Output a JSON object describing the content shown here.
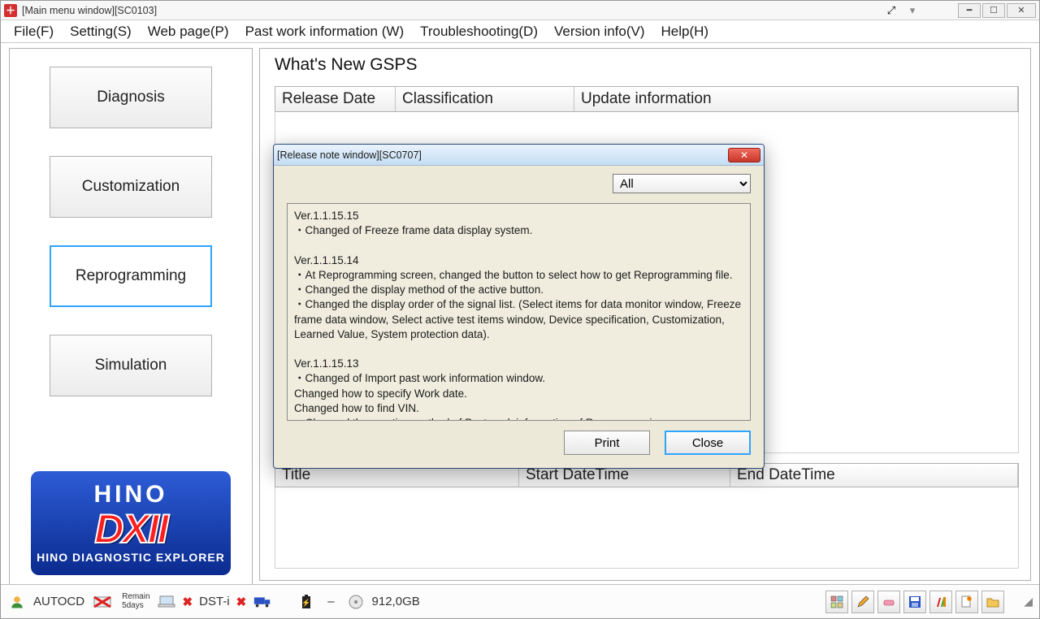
{
  "window": {
    "title": "[Main menu window][SC0103]"
  },
  "menubar": {
    "file": "File(F)",
    "setting": "Setting(S)",
    "webpage": "Web page(P)",
    "past_work": "Past work information (W)",
    "troubleshooting": "Troubleshooting(D)",
    "version": "Version info(V)",
    "help": "Help(H)"
  },
  "sidebar": {
    "diagnosis": "Diagnosis",
    "customization": "Customization",
    "reprogramming": "Reprogramming",
    "simulation": "Simulation"
  },
  "logo": {
    "line1": "HINO",
    "line2": "DXII",
    "line3": "HINO DIAGNOSTIC EXPLORER"
  },
  "whats_new": {
    "title": "What's New GSPS",
    "col1": "Release Date",
    "col2": "Classification",
    "col3": "Update information"
  },
  "resume": {
    "col1": "Title",
    "col2": "Start DateTime",
    "col3": "End DateTime"
  },
  "modal": {
    "title": "[Release note window][SC0707]",
    "filter_value": "All",
    "notes": "Ver.1.1.15.15\n・Changed of Freeze frame data display system.\n\nVer.1.1.15.14\n・At Reprogramming screen, changed the button to select how to get Reprogramming file.\n・Changed the display method of the active button.\n・Changed the display order of the signal list. (Select items for data monitor window, Freeze frame data window, Select active test items window, Device specification, Customization, Learned Value, System protection data).\n\nVer.1.1.15.13\n・Changed of Import past work information window.\n      Changed how to specify Work date.\n      Changed how to find VIN.\n・Changed the creation method of Past work information of Reprogramming.",
    "print": "Print",
    "close": "Close"
  },
  "statusbar": {
    "user": "AUTOCD",
    "remain": "Remain\n5days",
    "dst": "DST-i",
    "dash": "–",
    "disk": "912,0GB"
  }
}
